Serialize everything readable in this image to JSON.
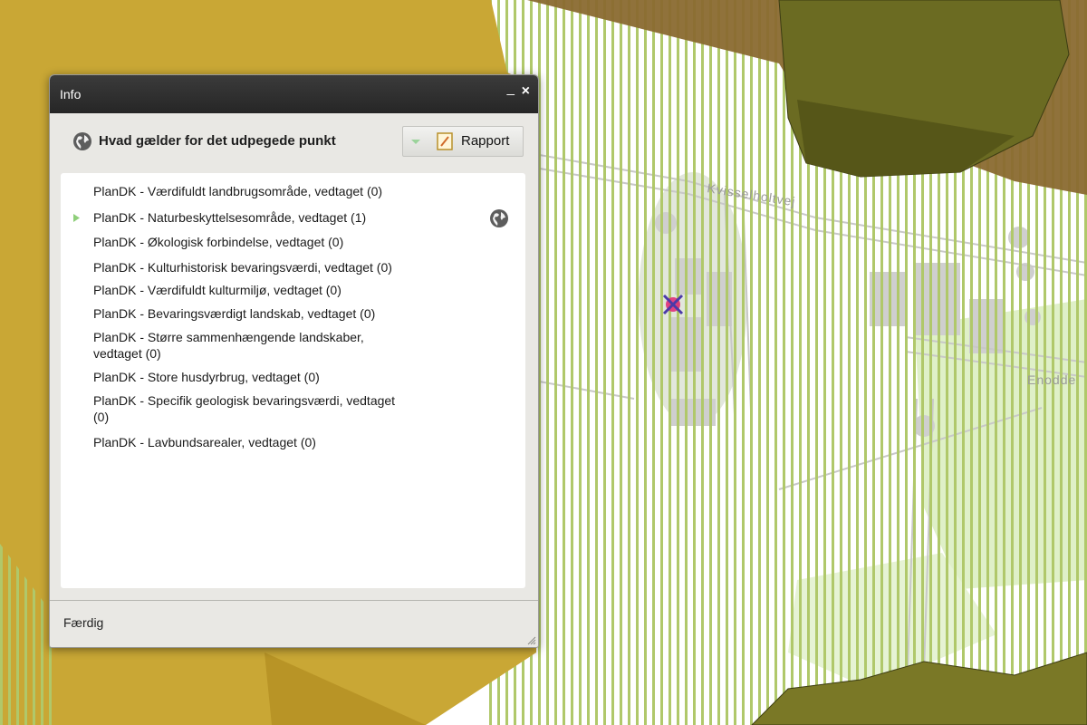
{
  "map": {
    "street_labels": [
      "Kvisselholtvej",
      "Enodde"
    ],
    "colors": {
      "agri_yellow": "#c9a735",
      "stripe_green": "#a9c45d",
      "brown": "#8a6a30",
      "olive_dark": "#6b6b22",
      "olive": "#8c8a2c"
    },
    "marker_icon": "selected-point-marker"
  },
  "window": {
    "title": "Info",
    "minimize_label": "_",
    "close_label": "×",
    "heading": "Hvad gælder for det udpegede punkt",
    "heading_icon": "globe-icon",
    "report_button_label": "Rapport",
    "status_text": "Færdig"
  },
  "results": [
    {
      "line1": "PlanDK - Værdifuldt landbrugsområde, vedtaget (0)",
      "line2": ""
    },
    {
      "line1": "PlanDK - Naturbeskyttelsesområde, vedtaget (1)",
      "line2": ""
    },
    {
      "line1": "PlanDK - Økologisk forbindelse, vedtaget (0)",
      "line2": ""
    },
    {
      "line1": "PlanDK - Kulturhistorisk bevaringsværdi, vedtaget (0)",
      "line2": ""
    },
    {
      "line1": "PlanDK - Værdifuldt kulturmiljø, vedtaget (0)",
      "line2": ""
    },
    {
      "line1": "PlanDK - Bevaringsværdigt landskab, vedtaget (0)",
      "line2": ""
    },
    {
      "line1": "PlanDK - Større sammenhængende landskaber,",
      "line2": "vedtaget (0)"
    },
    {
      "line1": "PlanDK - Store husdyrbrug, vedtaget (0)",
      "line2": ""
    },
    {
      "line1": "PlanDK - Specifik geologisk bevaringsværdi, vedtaget",
      "line2": "(0)"
    },
    {
      "line1": "PlanDK - Lavbundsarealer, vedtaget (0)",
      "line2": ""
    }
  ]
}
